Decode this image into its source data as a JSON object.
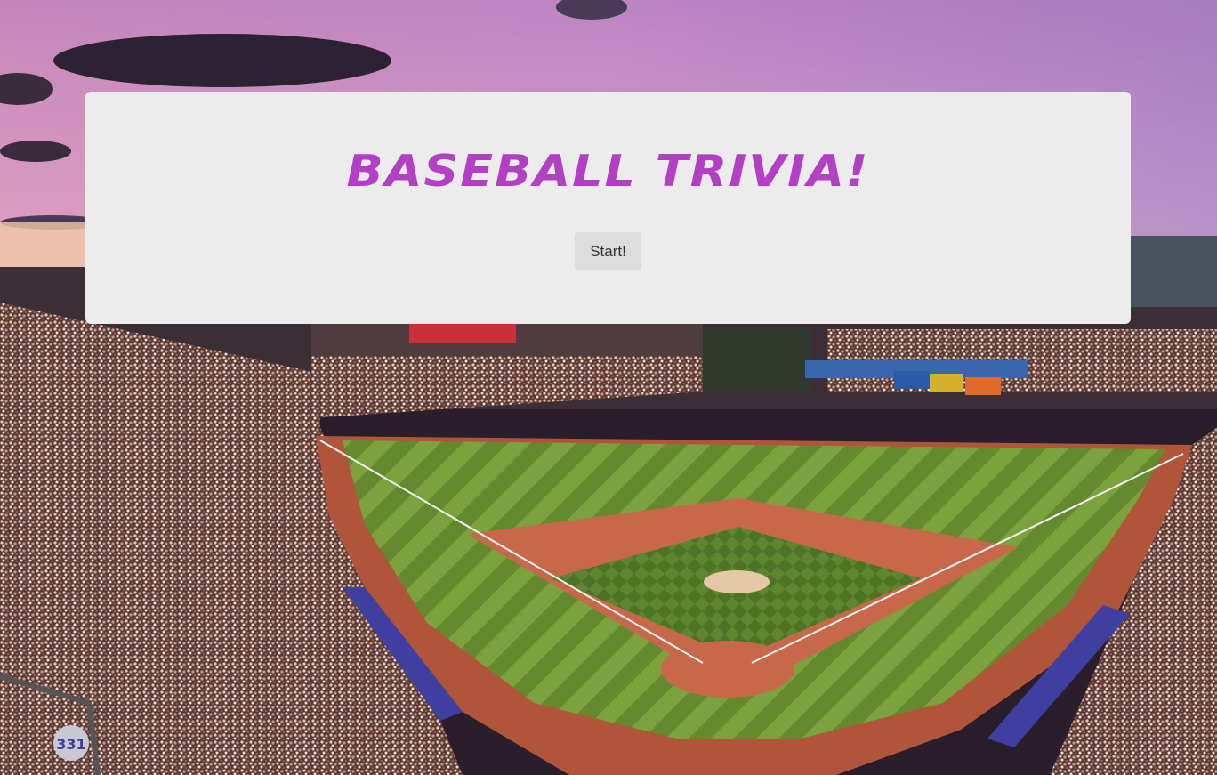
{
  "panel": {
    "title": "Baseball Trivia!",
    "start_label": "Start!"
  },
  "background": {
    "scoreboard_number": "331"
  }
}
